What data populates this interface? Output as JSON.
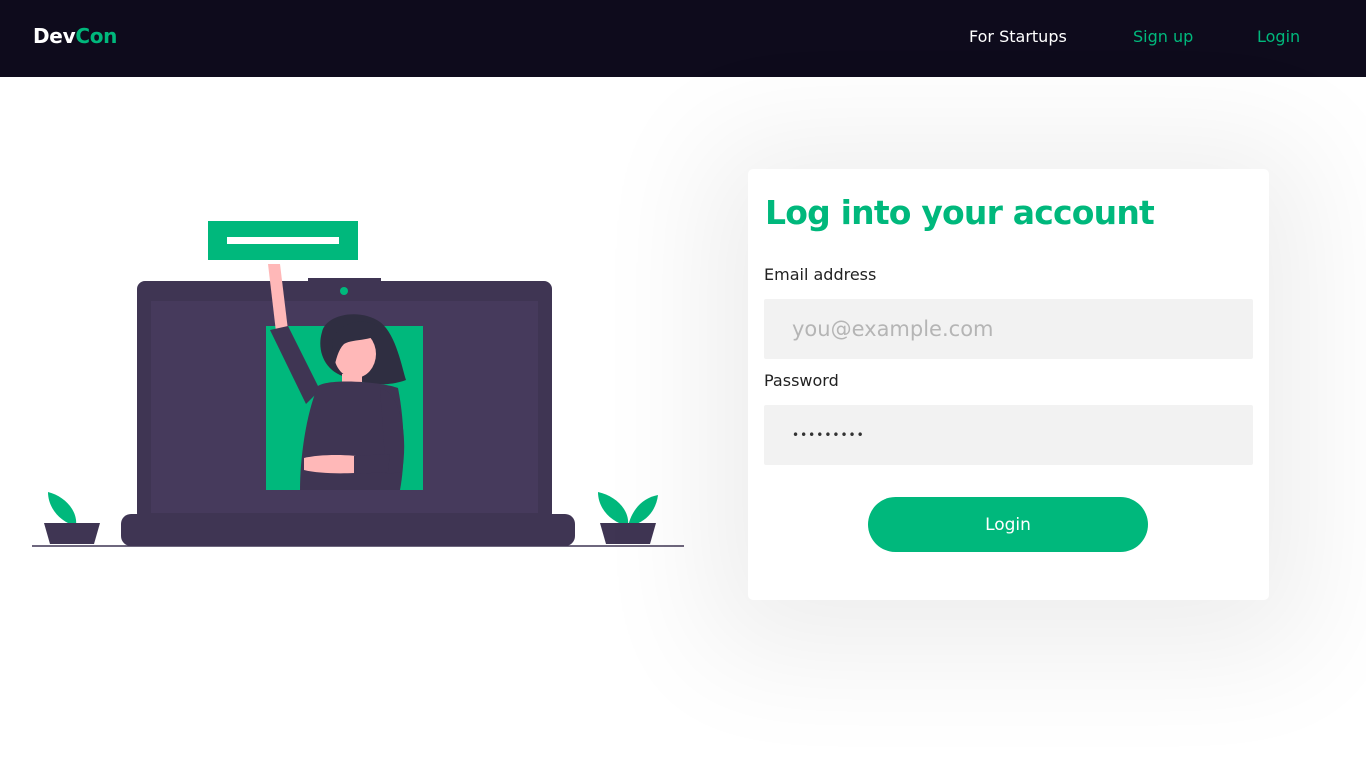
{
  "nav": {
    "brand_dev": "Dev",
    "brand_con": "Con",
    "links": {
      "startups": "For Startups",
      "signup": "Sign up",
      "login": "Login"
    }
  },
  "colors": {
    "accent": "#00b87c",
    "navbar_bg": "#0e0b1c",
    "laptop": "#3f3553",
    "skin": "#ffb8b8"
  },
  "form": {
    "title": "Log into your account",
    "email": {
      "label": "Email address",
      "placeholder": "you@example.com",
      "value": ""
    },
    "password": {
      "label": "Password",
      "value": "•••••••••"
    },
    "submit_label": "Login"
  }
}
